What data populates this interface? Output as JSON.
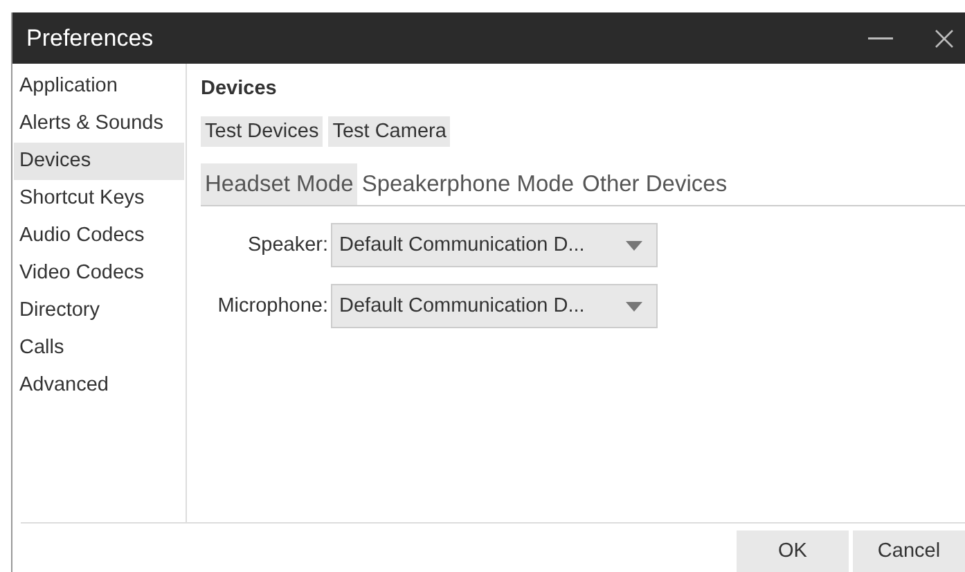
{
  "window": {
    "title": "Preferences"
  },
  "sidebar": {
    "items": [
      {
        "label": "Application",
        "selected": false
      },
      {
        "label": "Alerts & Sounds",
        "selected": false
      },
      {
        "label": "Devices",
        "selected": true
      },
      {
        "label": "Shortcut Keys",
        "selected": false
      },
      {
        "label": "Audio Codecs",
        "selected": false
      },
      {
        "label": "Video Codecs",
        "selected": false
      },
      {
        "label": "Directory",
        "selected": false
      },
      {
        "label": "Calls",
        "selected": false
      },
      {
        "label": "Advanced",
        "selected": false
      }
    ]
  },
  "panel": {
    "heading": "Devices",
    "actions": [
      "Test Devices",
      "Test Camera"
    ]
  },
  "tabs": [
    {
      "label": "Headset Mode",
      "selected": true
    },
    {
      "label": "Speakerphone Mode",
      "selected": false
    },
    {
      "label": "Other Devices",
      "selected": false
    }
  ],
  "fields": [
    {
      "label": "Speaker:",
      "value": "Default Communication D..."
    },
    {
      "label": "Microphone:",
      "value": "Default Communication D..."
    }
  ],
  "buttons": [
    "OK",
    "Cancel"
  ]
}
